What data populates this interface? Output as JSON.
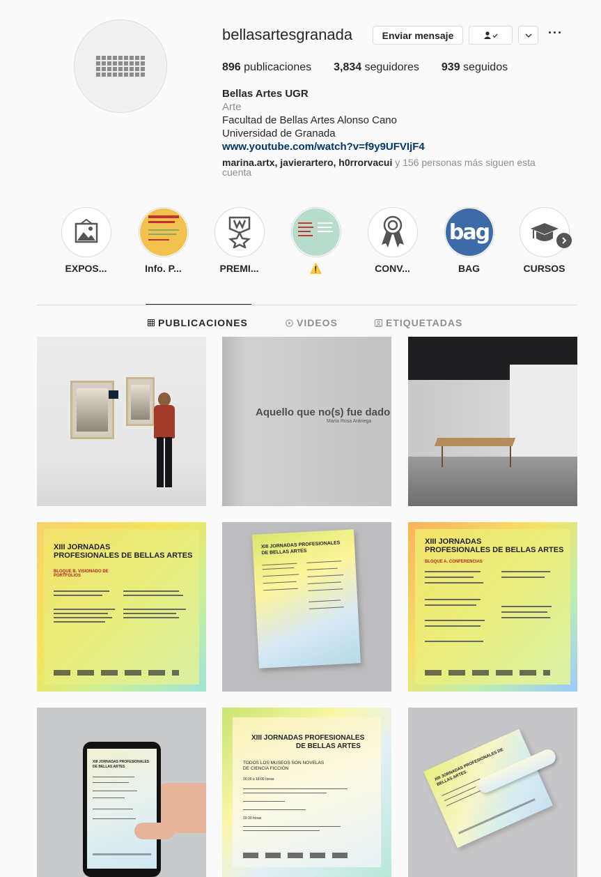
{
  "profile": {
    "username": "bellasartesgranada",
    "message_button": "Enviar mensaje",
    "stats": {
      "posts_count": "896",
      "posts_label": "publicaciones",
      "followers_count": "3,834",
      "followers_label": "seguidores",
      "following_count": "939",
      "following_label": "seguidos"
    },
    "bio": {
      "name": "Bellas Artes UGR",
      "category": "Arte",
      "line1": "Facultad de Bellas Artes Alonso Cano",
      "line2": "Universidad de Granada",
      "link": "www.youtube.com/watch?v=f9y9UFVIjF4",
      "followed_by_names": "marina.artx, javierartero, h0rrorvacui",
      "followed_by_rest": " y 156 personas más siguen esta cuenta"
    }
  },
  "highlights": [
    {
      "label": "EXPOS..."
    },
    {
      "label": "Info. P..."
    },
    {
      "label": "PREMI..."
    },
    {
      "label": "⚠️"
    },
    {
      "label": "CONV..."
    },
    {
      "label": "BAG"
    },
    {
      "label": "CURSOS"
    }
  ],
  "highlight_texts": {
    "bag_logo": "bag"
  },
  "tabs": [
    {
      "label": "PUBLICACIONES",
      "icon": "grid-icon"
    },
    {
      "label": "VIDEOS",
      "icon": "play-icon"
    },
    {
      "label": "ETIQUETADAS",
      "icon": "tag-icon"
    }
  ],
  "posts": {
    "p2_title": "Aquello que no(s) fue dado",
    "p2_subtitle": "María Rosa Aránega",
    "p4_title_1": "XIII JORNADAS",
    "p4_title_2": "PROFESIONALES DE BELLAS ARTES",
    "p4_block": "BLOQUE B. VISIONADO DE PORTFOLIOS",
    "p6_title_1": "XIII JORNADAS",
    "p6_title_2": "PROFESIONALES DE BELLAS ARTES",
    "p6_block": "BLOQUE A. CONFERENCIAS",
    "p5_title": "XIII JORNADAS PROFESIONALES DE BELLAS ARTES",
    "p7_title": "XIII JORNADAS PROFESIONALES DE BELLAS ARTES",
    "p8_title_1": "XIII JORNADAS PROFESIONALES",
    "p8_title_2": "DE BELLAS ARTES",
    "p8_sub": "TODOS LOS MUSEOS SON NOVELAS DE CIENCIA FICCIÓN",
    "p8_time": "16:00 a 18:00 horas",
    "p8_time2": "19:30 horas",
    "p9_title": "XIII JORNADAS PROFESIONALES DE BELLAS ARTES"
  },
  "colors": {
    "link": "#00376b",
    "muted": "#8e8e8e",
    "border": "#dbdbdb"
  }
}
